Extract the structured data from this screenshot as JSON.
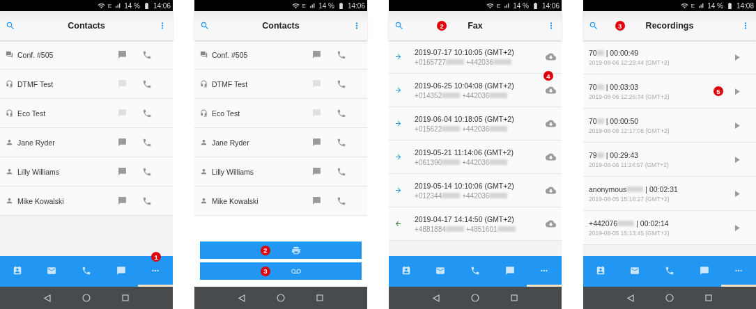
{
  "screens": [
    {
      "kind": "contacts",
      "status": {
        "network": "E",
        "battery": "14 %",
        "time": "14:06"
      },
      "title": "Contacts",
      "contacts": [
        {
          "kind": "conference",
          "name": "Conf. #505",
          "chat_enabled": true
        },
        {
          "kind": "service",
          "name": "DTMF Test",
          "chat_enabled": false
        },
        {
          "kind": "service",
          "name": "Eco Test",
          "chat_enabled": false
        },
        {
          "kind": "person",
          "name": "Jane Ryder",
          "chat_enabled": true
        },
        {
          "kind": "person",
          "name": "Lilly Williams",
          "chat_enabled": true
        },
        {
          "kind": "person",
          "name": "Mike Kowalski",
          "chat_enabled": true
        }
      ],
      "nav": [
        {
          "kind": "contacts",
          "selected": false
        },
        {
          "kind": "mail",
          "selected": false
        },
        {
          "kind": "calls",
          "selected": false
        },
        {
          "kind": "chat",
          "selected": false
        },
        {
          "kind": "more",
          "selected": true,
          "badge": "1"
        }
      ]
    },
    {
      "kind": "contacts",
      "status": {
        "network": "E",
        "battery": "14 %",
        "time": "14:06"
      },
      "title": "Contacts",
      "contacts": [
        {
          "kind": "conference",
          "name": "Conf. #505",
          "chat_enabled": true
        },
        {
          "kind": "service",
          "name": "DTMF Test",
          "chat_enabled": false
        },
        {
          "kind": "service",
          "name": "Eco Test",
          "chat_enabled": false
        },
        {
          "kind": "person",
          "name": "Jane Ryder",
          "chat_enabled": true
        },
        {
          "kind": "person",
          "name": "Lilly Williams",
          "chat_enabled": true
        },
        {
          "kind": "person",
          "name": "Mike Kowalski",
          "chat_enabled": true
        }
      ],
      "action_sheet": [
        {
          "kind": "fax",
          "badge": "2"
        },
        {
          "kind": "voicemail",
          "badge": "3"
        }
      ]
    },
    {
      "kind": "fax",
      "status": {
        "network": "E",
        "battery": "14 %",
        "time": "14:06"
      },
      "title": "Fax",
      "title_badge": "2",
      "faxes": [
        {
          "kind": "outgoing",
          "date": "2019-07-17 10:10:05 (GMT+2)",
          "from": "+0165727",
          "to": "+442036"
        },
        {
          "kind": "outgoing",
          "date": "2019-06-25 10:04:08 (GMT+2)",
          "from": "+014352",
          "to": "+442036",
          "badge": "4"
        },
        {
          "kind": "outgoing",
          "date": "2019-06-04 10:18:05 (GMT+2)",
          "from": "+015622",
          "to": "+442036"
        },
        {
          "kind": "outgoing",
          "date": "2019-05-21 11:14:06 (GMT+2)",
          "from": "+061390",
          "to": "+442036"
        },
        {
          "kind": "outgoing",
          "date": "2019-05-14 10:10:06 (GMT+2)",
          "from": "+012344",
          "to": "+442036"
        },
        {
          "kind": "incoming",
          "date": "2019-04-17 14:14:50 (GMT+2)",
          "from": "+4881884",
          "to": "+4851601"
        }
      ],
      "nav": [
        {
          "kind": "contacts",
          "selected": false
        },
        {
          "kind": "mail",
          "selected": false
        },
        {
          "kind": "calls",
          "selected": false
        },
        {
          "kind": "chat",
          "selected": false
        },
        {
          "kind": "more",
          "selected": true
        }
      ]
    },
    {
      "kind": "recordings",
      "status": {
        "network": "E",
        "battery": "14 %",
        "time": "14:08"
      },
      "title": "Recordings",
      "title_badge": "3",
      "recordings": [
        {
          "caller": "70",
          "duration": "| 00:00:49",
          "date": "2019-08-06 12:29:44 (GMT+2)"
        },
        {
          "caller": "70",
          "duration": "| 00:03:03",
          "date": "2019-08-06 12:26:34 (GMT+2)",
          "badge": "5"
        },
        {
          "caller": "70",
          "duration": "| 00:00:50",
          "date": "2019-08-06 12:17:08 (GMT+2)"
        },
        {
          "caller": "79",
          "duration": "| 00:29:43",
          "date": "2019-08-06 11:24:57 (GMT+2)"
        },
        {
          "caller": "anonymous",
          "duration": "| 00:02:31",
          "date": "2019-08-05 15:18:27 (GMT+2)"
        },
        {
          "caller": "+442076",
          "duration": "| 00:02:14",
          "date": "2019-08-05 15:13:45 (GMT+2)"
        }
      ],
      "nav": [
        {
          "kind": "contacts",
          "selected": false
        },
        {
          "kind": "mail",
          "selected": false
        },
        {
          "kind": "calls",
          "selected": false
        },
        {
          "kind": "chat",
          "selected": false
        },
        {
          "kind": "more",
          "selected": true
        }
      ]
    }
  ]
}
